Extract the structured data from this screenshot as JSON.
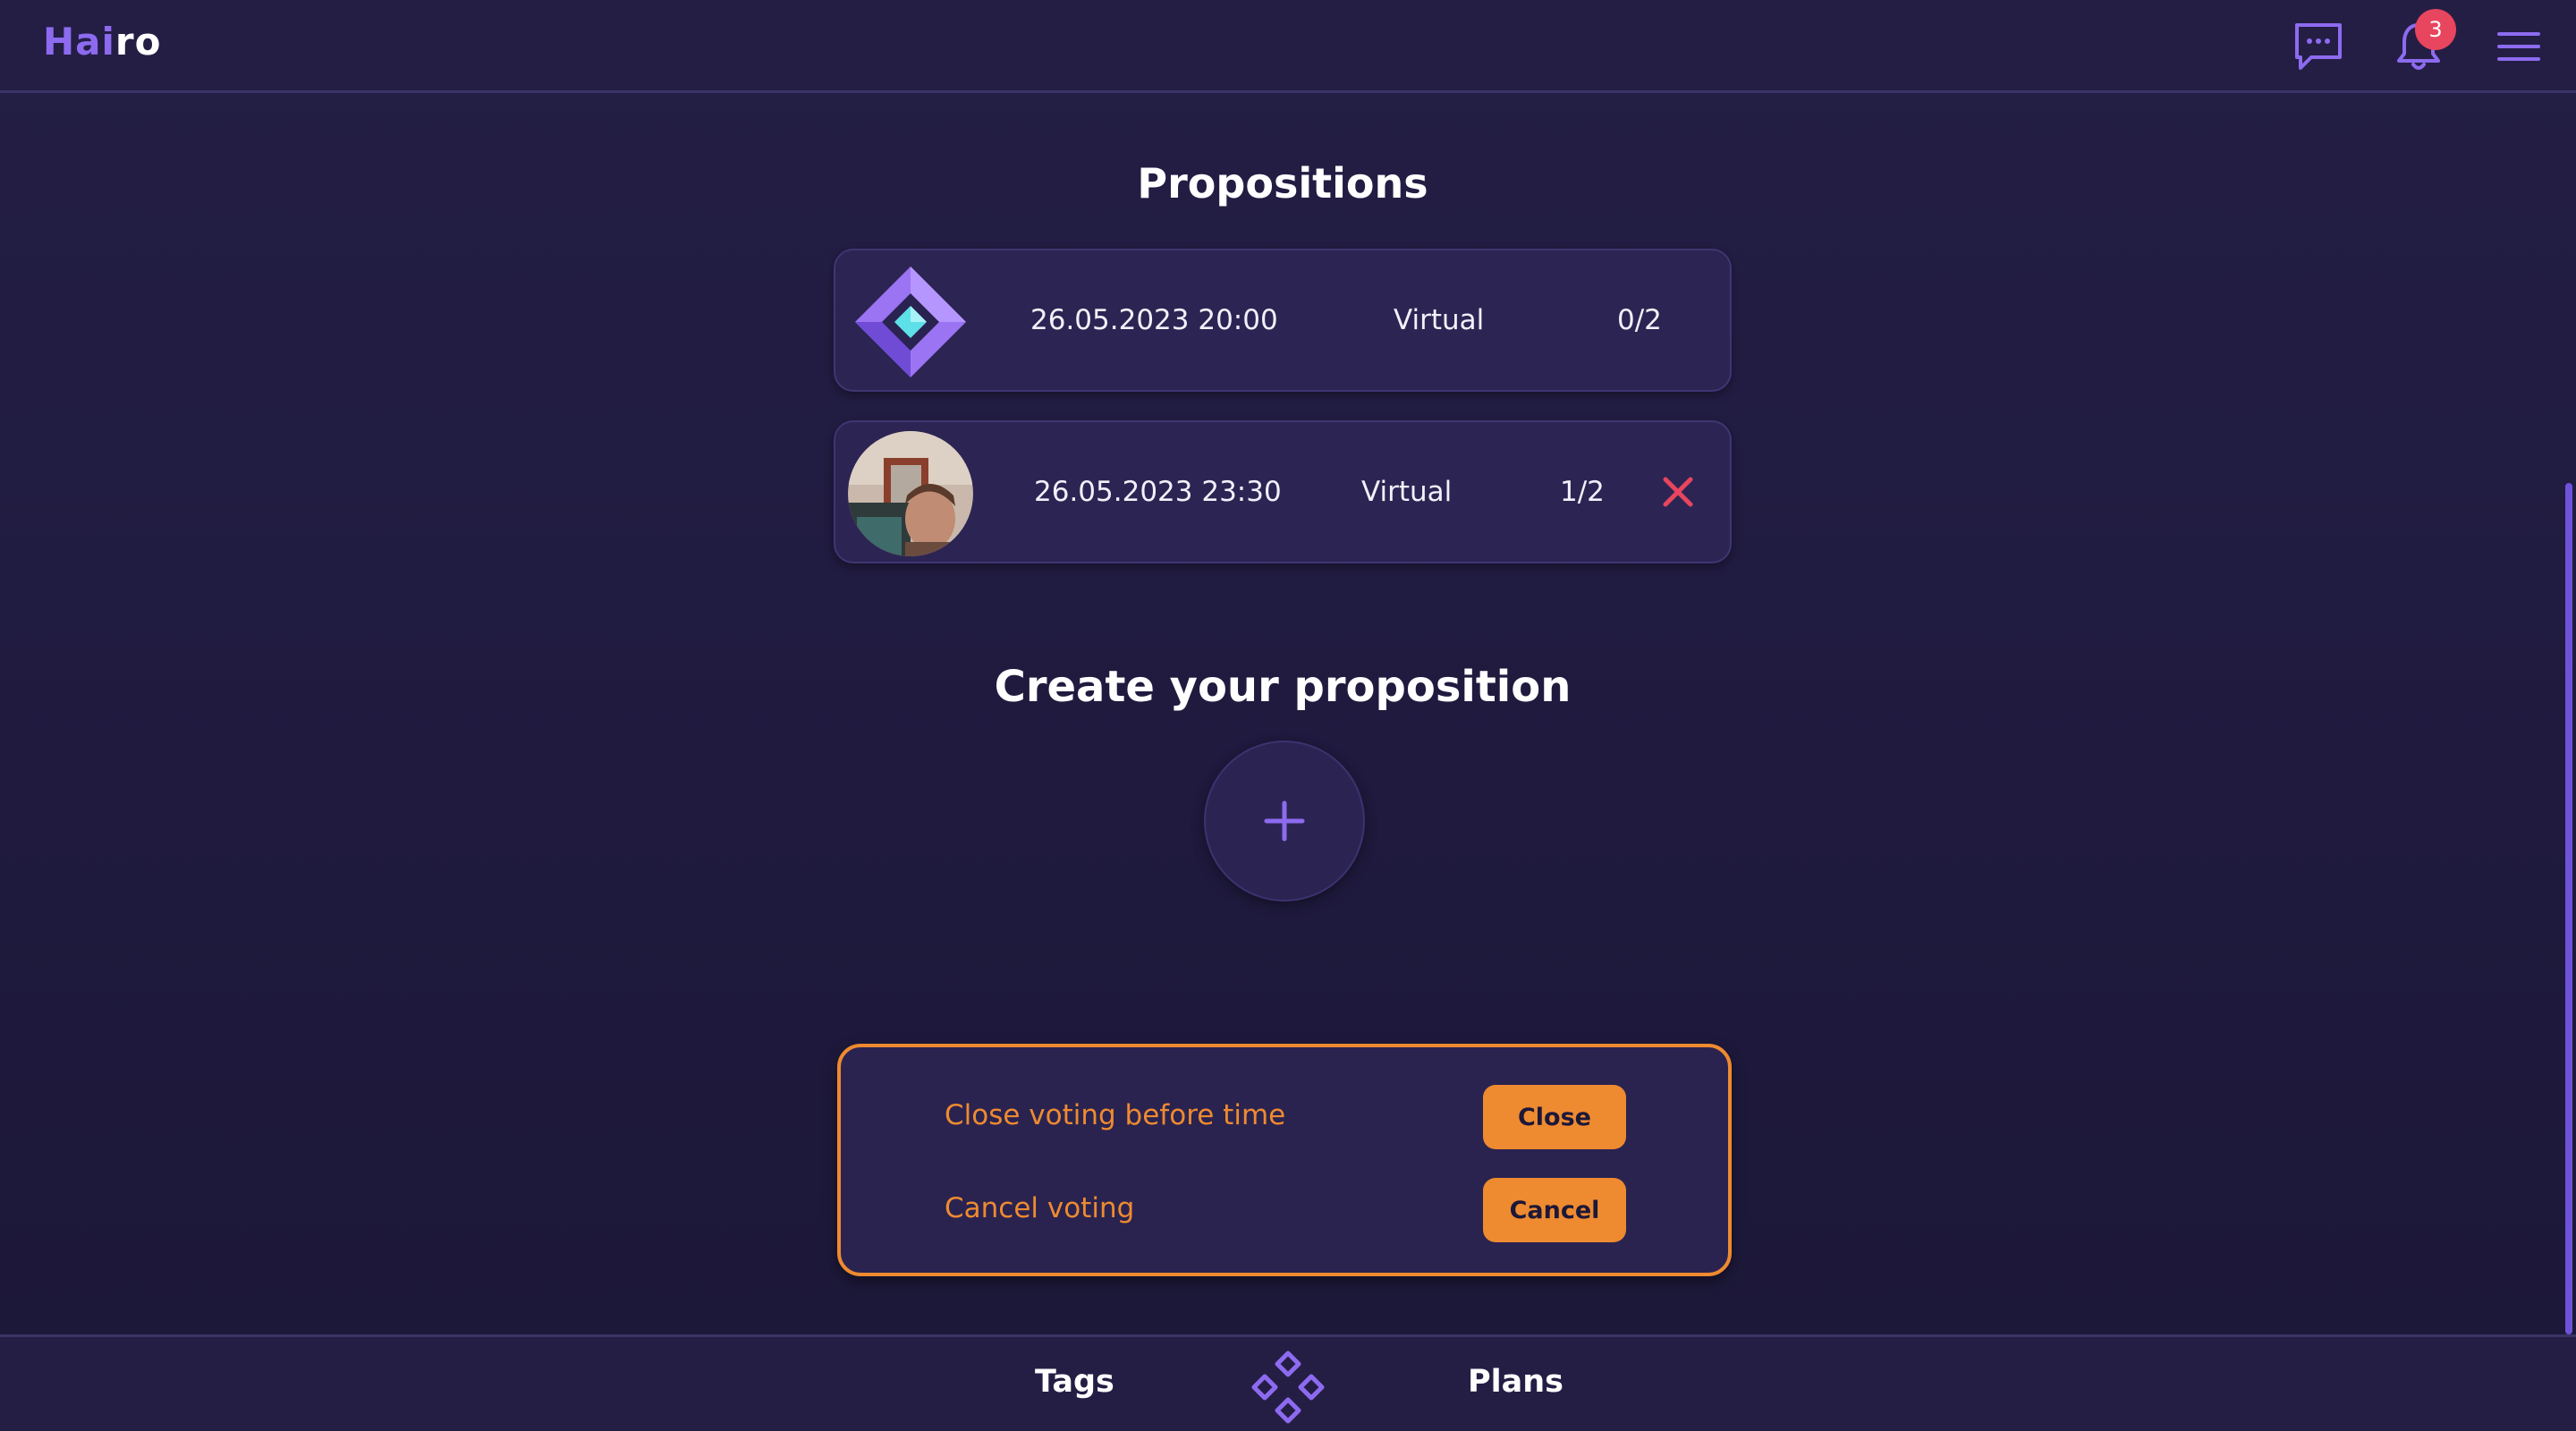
{
  "app": {
    "logo_part1": "Hai",
    "logo_part2": "ro"
  },
  "header": {
    "notification_count": "3",
    "icons": [
      "chat-icon",
      "bell-icon",
      "menu-icon"
    ]
  },
  "propositions": {
    "title": "Propositions",
    "items": [
      {
        "avatar": "brand-diamond-icon",
        "datetime": "26.05.2023 20:00",
        "type": "Virtual",
        "votes": "0/2",
        "removable": false
      },
      {
        "avatar": "user-photo",
        "datetime": "26.05.2023 23:30",
        "type": "Virtual",
        "votes": "1/2",
        "removable": true
      }
    ]
  },
  "create": {
    "title": "Create your proposition",
    "add_symbol": "+"
  },
  "voting_panel": {
    "close_label": "Close voting before time",
    "close_button": "Close",
    "cancel_label": "Cancel voting",
    "cancel_button": "Cancel"
  },
  "bottom_nav": {
    "left": "Tags",
    "right": "Plans",
    "center_icon": "diamond-grid-icon"
  },
  "colors": {
    "accent": "#8d6bf0",
    "warning": "#ee8a30",
    "danger": "#e8455e",
    "background": "#211b41"
  }
}
